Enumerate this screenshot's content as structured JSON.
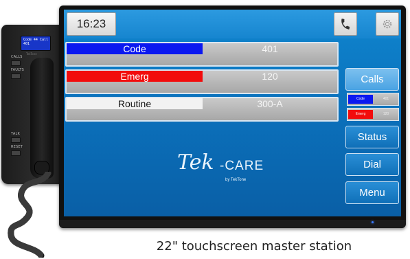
{
  "desk_phone": {
    "lcd_line1_left": "Code",
    "lcd_line1_right": "44 Call",
    "lcd_line2": "401",
    "brand": "TekTone",
    "buttons": [
      "CALLS",
      "FAULTS",
      "TALK",
      "RESET"
    ]
  },
  "screen": {
    "clock": "16:23",
    "call_rows": [
      {
        "type": "Code",
        "room": "401",
        "color": "#0b18f0",
        "text_color": "#ffffff"
      },
      {
        "type": "Emerg",
        "room": "120",
        "color": "#f20c0c",
        "text_color": "#ffffff"
      },
      {
        "type": "Routine",
        "room": "300-A",
        "color": "#f2f2f2",
        "text_color": "#111111"
      }
    ],
    "side_tabs": {
      "calls": "Calls",
      "status": "Status",
      "dial": "Dial",
      "menu": "Menu"
    },
    "mini_calls": [
      {
        "type": "Code",
        "room": "401",
        "color": "#0b18f0"
      },
      {
        "type": "Emerg",
        "room": "120",
        "color": "#f20c0c"
      }
    ],
    "logo": {
      "tek": "Tek",
      "care": "-CARE",
      "by": "by TekTone"
    }
  },
  "caption": "22\" touchscreen master station",
  "icons": {
    "phone": "phone-icon",
    "settings": "gear-icon"
  }
}
